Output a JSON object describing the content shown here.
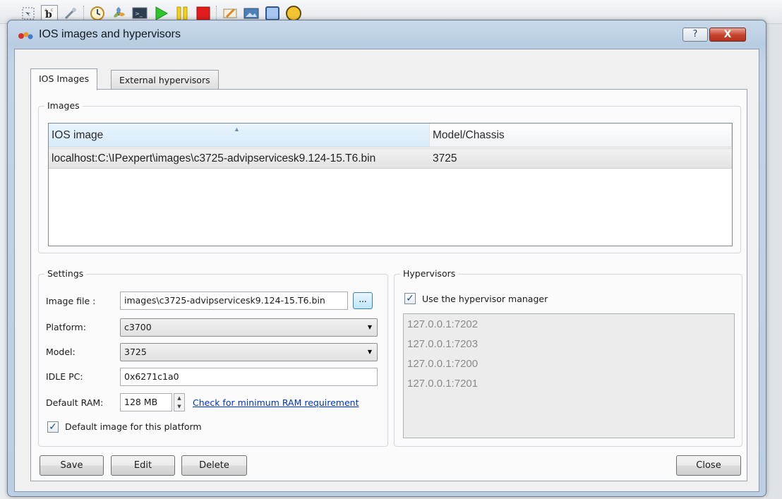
{
  "window": {
    "title": "IOS images and hypervisors",
    "help_label": "?",
    "close_label": "X"
  },
  "toolbar": {
    "icons": [
      "select-icon",
      "text-icon",
      "capture-icon",
      "clock-icon",
      "fan-icon",
      "console-icon",
      "play-icon",
      "pause-icon",
      "stop-icon",
      "note-icon",
      "picture-icon",
      "rectangle-icon",
      "ellipse-icon"
    ]
  },
  "tabs": [
    {
      "label": "IOS Images",
      "active": true
    },
    {
      "label": "External hypervisors",
      "active": false
    }
  ],
  "images": {
    "group_title": "Images",
    "columns": [
      "IOS image",
      "Model/Chassis"
    ],
    "rows": [
      [
        "localhost:C:\\IPexpert\\images\\c3725-advipservicesk9.124-15.T6.bin",
        "3725"
      ]
    ]
  },
  "settings": {
    "group_title": "Settings",
    "image_file_label": "Image file :",
    "image_file_value": "images\\c3725-advipservicesk9.124-15.T6.bin",
    "browse_label": "...",
    "platform_label": "Platform:",
    "platform_value": "c3700",
    "model_label": "Model:",
    "model_value": "3725",
    "idle_pc_label": "IDLE PC:",
    "idle_pc_value": "0x6271c1a0",
    "ram_label": "Default RAM:",
    "ram_value": "128 MB",
    "ram_link": "Check for minimum RAM requirement",
    "default_image_label": "Default image for this platform",
    "default_image_checked": true
  },
  "hypervisors": {
    "group_title": "Hypervisors",
    "use_manager_label": "Use the hypervisor manager",
    "use_manager_checked": true,
    "items": [
      "127.0.0.1:7202",
      "127.0.0.1:7203",
      "127.0.0.1:7200",
      "127.0.0.1:7201"
    ]
  },
  "buttons": {
    "save": "Save",
    "edit": "Edit",
    "delete": "Delete",
    "close": "Close"
  },
  "check_glyph": "✓"
}
